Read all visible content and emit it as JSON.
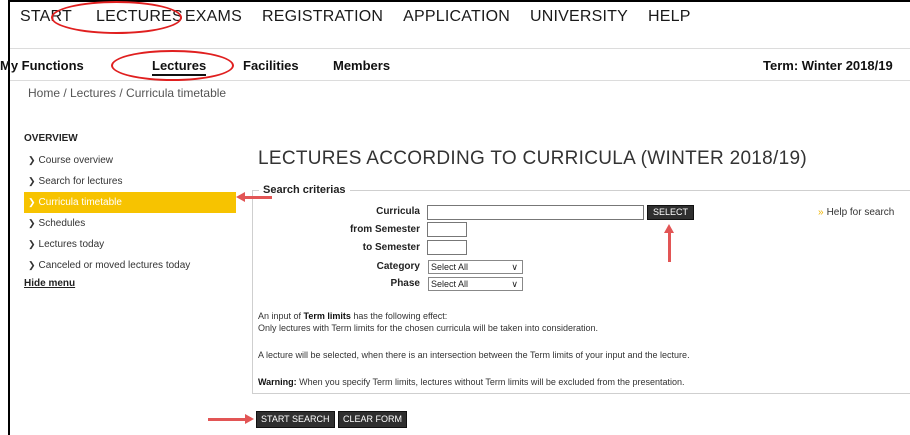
{
  "top_nav": [
    "START",
    "LECTURES",
    "EXAMS",
    "REGISTRATION",
    "APPLICATION",
    "UNIVERSITY",
    "HELP"
  ],
  "sub_nav": {
    "my_functions": "My Functions",
    "lectures": "Lectures",
    "facilities": "Facilities",
    "members": "Members",
    "term": "Term: Winter 2018/19"
  },
  "breadcrumb": "Home  / Lectures / Curricula timetable",
  "sidebar": {
    "heading": "OVERVIEW",
    "items": [
      "Course overview",
      "Search for lectures",
      "Curricula timetable",
      "Schedules",
      "Lectures today",
      "Canceled or moved lectures today"
    ],
    "active_item": "Curricula timetable",
    "hide_menu": "Hide menu"
  },
  "main": {
    "title": "LECTURES ACCORDING TO CURRICULA (WINTER 2018/19)",
    "legend": "Search criterias",
    "fields": {
      "curricula_label": "Curricula",
      "curricula_value": "",
      "from_semester_label": "from Semester",
      "from_semester_value": "",
      "to_semester_label": "to Semester",
      "to_semester_value": "",
      "category_label": "Category",
      "category_value": "Select All",
      "phase_label": "Phase",
      "phase_value": "Select All"
    },
    "select_button": "SELECT",
    "help_link": "Help for search",
    "info": {
      "line1_pre": "An input of ",
      "line1_bold": "Term limits",
      "line1_post": " has the following effect:",
      "line2": "Only lectures with Term limits for the chosen curricula will be taken into consideration.",
      "line3": "A lecture will be selected, when there is an intersection between the Term limits of your input and the lecture.",
      "warning_bold": "Warning:",
      "warning_text": " When you specify Term limits, lectures without Term limits will be excluded from the presentation."
    },
    "start_search": "START SEARCH",
    "clear_form": "CLEAR FORM"
  },
  "colors": {
    "active_sidebar": "#f7c300",
    "annotation": "#e01f1f",
    "button": "#2f2f2f"
  }
}
